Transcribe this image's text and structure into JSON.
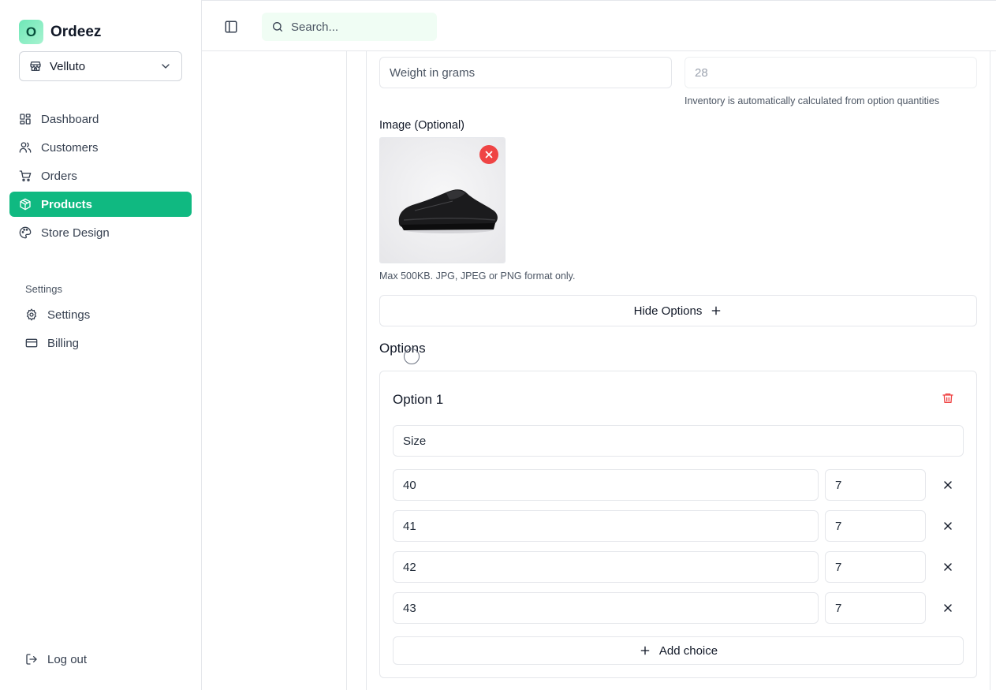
{
  "brand": {
    "logo_letter": "O",
    "name": "Ordeez"
  },
  "store": {
    "name": "Velluto"
  },
  "nav": {
    "items": [
      {
        "label": "Dashboard",
        "icon": "dashboard-icon"
      },
      {
        "label": "Customers",
        "icon": "users-icon"
      },
      {
        "label": "Orders",
        "icon": "cart-icon"
      },
      {
        "label": "Products",
        "icon": "box-icon",
        "active": true
      },
      {
        "label": "Store Design",
        "icon": "palette-icon"
      }
    ],
    "settings_heading": "Settings",
    "settings_items": [
      {
        "label": "Settings",
        "icon": "gear-icon"
      },
      {
        "label": "Billing",
        "icon": "credit-card-icon"
      }
    ],
    "logout": "Log out"
  },
  "header": {
    "search_placeholder": "Search..."
  },
  "form": {
    "weight_placeholder": "Weight in grams",
    "inventory_value": "28",
    "inventory_hint": "Inventory is automatically calculated from option quantities",
    "image_label": "Image (Optional)",
    "image_hint": "Max 500KB. JPG, JPEG or PNG format only.",
    "hide_options_label": "Hide Options",
    "options_title": "Options"
  },
  "option": {
    "title": "Option 1",
    "name_value": "Size",
    "choices": [
      {
        "value": "40",
        "qty": "7"
      },
      {
        "value": "41",
        "qty": "7"
      },
      {
        "value": "42",
        "qty": "7"
      },
      {
        "value": "43",
        "qty": "7"
      }
    ],
    "add_choice_label": "Add choice"
  },
  "colors": {
    "accent": "#10b981",
    "danger": "#ef4444"
  }
}
